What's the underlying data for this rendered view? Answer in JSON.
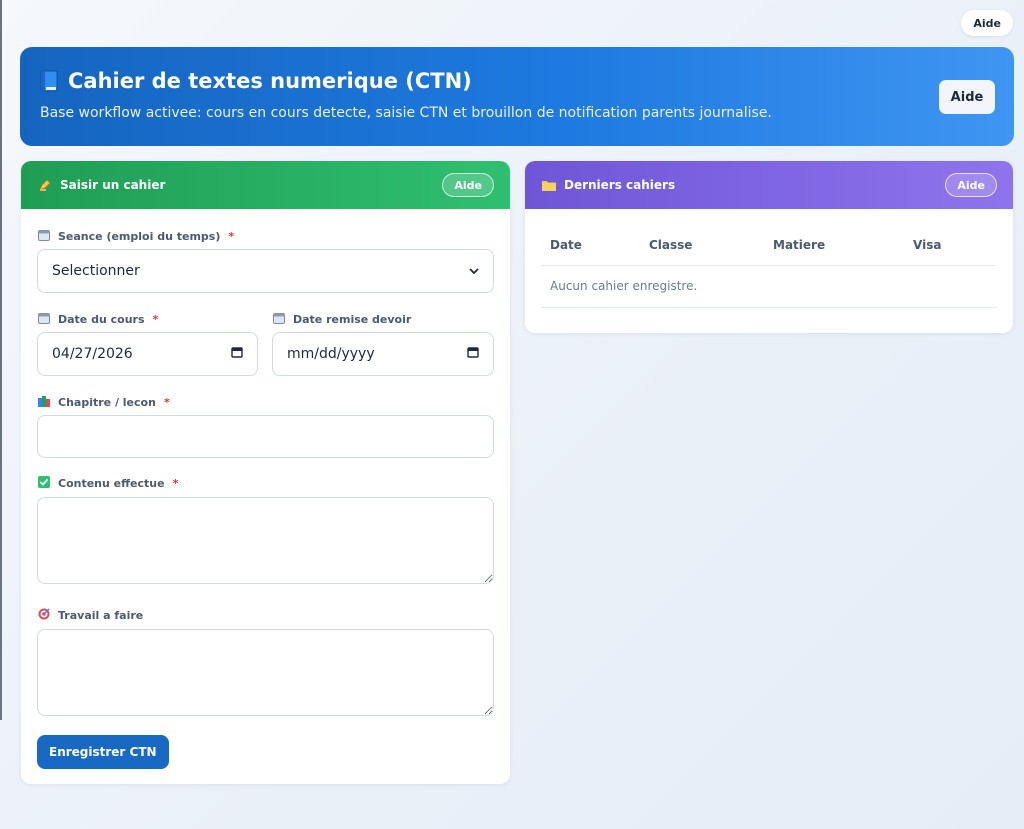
{
  "top_help": "Aide",
  "hero": {
    "title": "Cahier de textes numerique (CTN)",
    "subtitle": "Base workflow activee: cours en cours detecte, saisie CTN et brouillon de notification parents journalise.",
    "help": "Aide"
  },
  "form": {
    "title": "Saisir un cahier",
    "help": "Aide",
    "seance_label": "Seance (emploi du temps)",
    "seance_value": "Selectionner",
    "date_cours_label": "Date du cours",
    "date_cours_value": "04/27/2026",
    "date_remise_label": "Date remise devoir",
    "date_remise_value": "mm/dd/yyyy",
    "chapitre_label": "Chapitre / lecon",
    "contenu_label": "Contenu effectue",
    "travail_label": "Travail a faire",
    "required_mark": "*",
    "save_label": "Enregistrer CTN"
  },
  "list": {
    "title": "Derniers cahiers",
    "help": "Aide",
    "columns": [
      "Date",
      "Classe",
      "Matiere",
      "Visa"
    ],
    "empty": "Aucun cahier enregistre."
  },
  "colors": {
    "hero": "#1e7ae0",
    "form_header": "#2fbf71",
    "list_header": "#8e74ec",
    "primary_button": "#1769c4",
    "required": "#d23b3b"
  }
}
